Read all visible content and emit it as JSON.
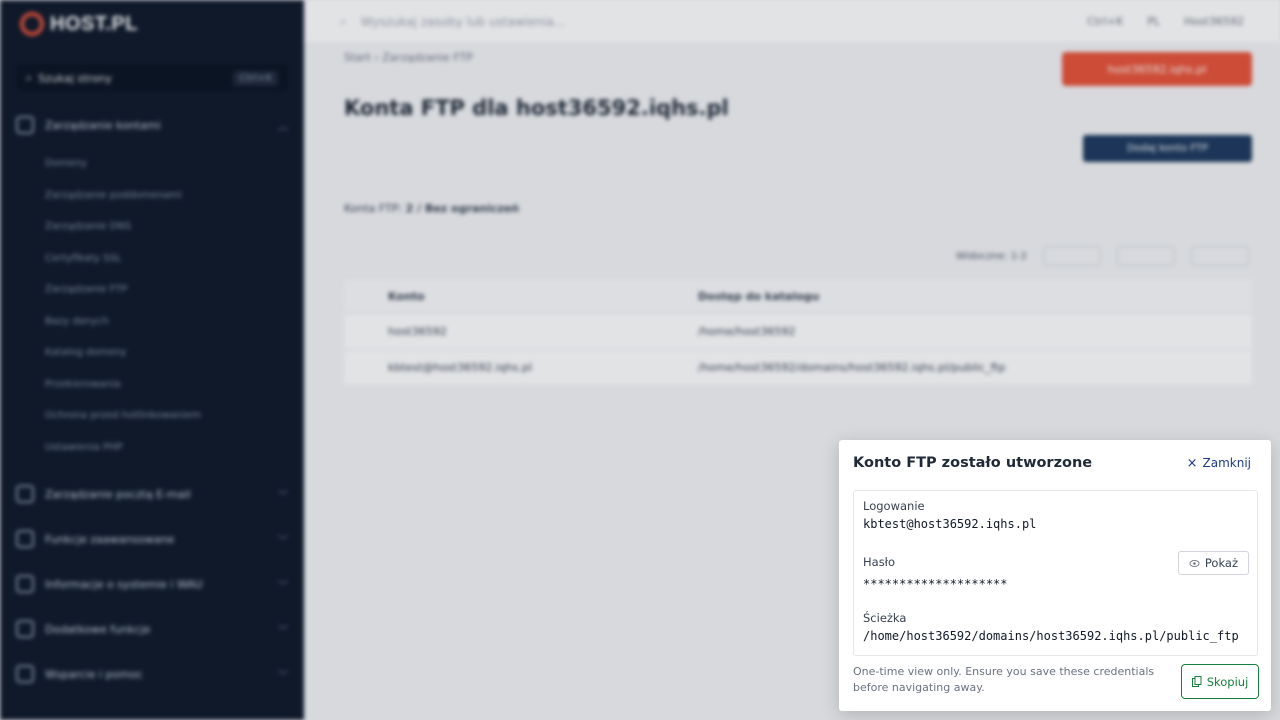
{
  "sidebar": {
    "brand": "HOST.PL",
    "search_placeholder": "Szukaj strony",
    "search_shortcut": "Ctrl+K",
    "groups": [
      {
        "label": "Zarządzanie kontami"
      },
      {
        "label": "Zarządzanie pocztą E-mail"
      },
      {
        "label": "Funkcje zaawansowane"
      },
      {
        "label": "Informacje o systemie i WAU"
      },
      {
        "label": "Dodatkowe funkcje"
      },
      {
        "label": "Wsparcie i pomoc"
      }
    ],
    "subitems": [
      "Domeny",
      "Zarządzanie poddomenami",
      "Zarządzanie DNS",
      "Certyfikaty SSL",
      "Zarządzanie FTP",
      "Bazy danych",
      "Katalog domeny",
      "Przekierowania",
      "Ochrona przed hotlinkowaniem",
      "Ustawienia PHP"
    ]
  },
  "topbar": {
    "search_placeholder": "Wyszukaj zasoby lub ustawienia...",
    "shortcut": "Ctrl+K",
    "language": "PL",
    "user": "Host36592"
  },
  "page": {
    "breadcrumb": "Start › Zarządzanie FTP",
    "title": "Konta FTP dla host36592.iqhs.pl",
    "primary_button": "host36592.iqhs.pl",
    "secondary_button": "Dodaj konto FTP",
    "info_label": "Konta FTP:",
    "info_value": "2 / Bez ograniczeń",
    "pagination_text": "Widoczne: 1-2",
    "table": {
      "headers": [
        "Konto",
        "Dostęp do katalogu"
      ],
      "rows": [
        [
          "host36592",
          "/home/host36592"
        ],
        [
          "kbtest@host36592.iqhs.pl",
          "/home/host36592/domains/host36592.iqhs.pl/public_ftp"
        ]
      ]
    }
  },
  "modal": {
    "title": "Konto FTP zostało utworzone",
    "close_label": "Zamknij",
    "login_label": "Logowanie",
    "login_value": "kbtest@host36592.iqhs.pl",
    "password_label": "Hasło",
    "password_value": "********************",
    "show_label": "Pokaż",
    "path_label": "Ścieżka",
    "path_value": "/home/host36592/domains/host36592.iqhs.pl/public_ftp",
    "note": "One-time view only. Ensure you save these credentials before navigating away.",
    "copy_label": "Skopiuj"
  }
}
